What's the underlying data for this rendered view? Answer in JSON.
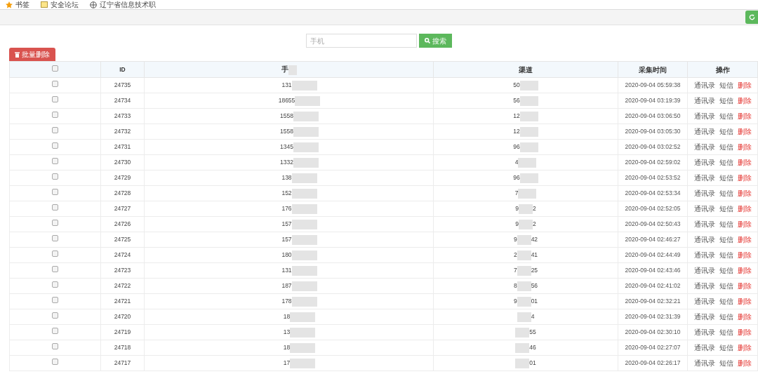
{
  "bookmarks": [
    {
      "kind": "star",
      "label": "书签"
    },
    {
      "kind": "folder",
      "label": "安全论坛"
    },
    {
      "kind": "globe",
      "label": "辽宁省信息技术职"
    }
  ],
  "search": {
    "placeholder": "手机",
    "button": "搜索"
  },
  "batch_delete": "批量删除",
  "table": {
    "select_all": {
      "checked": false
    },
    "columns": [
      "ID",
      "手",
      "渠道",
      "采集时间",
      "操作"
    ],
    "rows": [
      {
        "checked": false,
        "id": "24735",
        "phone": "131",
        "channel": "50",
        "channel_tail": "",
        "time": "2020-09-04 05:59:38",
        "actions": [
          "通讯录",
          "短信",
          "删除"
        ]
      },
      {
        "checked": false,
        "id": "24734",
        "phone": "18655",
        "channel": "56",
        "channel_tail": "",
        "time": "2020-09-04 03:19:39",
        "actions": [
          "通讯录",
          "短信",
          "删除"
        ]
      },
      {
        "checked": false,
        "id": "24733",
        "phone": "1558",
        "channel": "12",
        "channel_tail": "",
        "time": "2020-09-04 03:06:50",
        "actions": [
          "通讯录",
          "短信",
          "删除"
        ]
      },
      {
        "checked": false,
        "id": "24732",
        "phone": "1558",
        "channel": "12",
        "channel_tail": "",
        "time": "2020-09-04 03:05:30",
        "actions": [
          "通讯录",
          "短信",
          "删除"
        ]
      },
      {
        "checked": false,
        "id": "24731",
        "phone": "1345",
        "channel": "96",
        "channel_tail": "",
        "time": "2020-09-04 03:02:52",
        "actions": [
          "通讯录",
          "短信",
          "删除"
        ]
      },
      {
        "checked": false,
        "id": "24730",
        "phone": "1332",
        "channel": "4",
        "channel_tail": "",
        "time": "2020-09-04 02:59:02",
        "actions": [
          "通讯录",
          "短信",
          "删除"
        ]
      },
      {
        "checked": false,
        "id": "24729",
        "phone": "138",
        "channel": "96",
        "channel_tail": "",
        "time": "2020-09-04 02:53:52",
        "actions": [
          "通讯录",
          "短信",
          "删除"
        ]
      },
      {
        "checked": false,
        "id": "24728",
        "phone": "152",
        "channel": "7",
        "channel_tail": "",
        "time": "2020-09-04 02:53:34",
        "actions": [
          "通讯录",
          "短信",
          "删除"
        ]
      },
      {
        "checked": false,
        "id": "24727",
        "phone": "176",
        "channel": "9",
        "channel_tail": "2",
        "time": "2020-09-04 02:52:05",
        "actions": [
          "通讯录",
          "短信",
          "删除"
        ]
      },
      {
        "checked": false,
        "id": "24726",
        "phone": "157",
        "channel": "9",
        "channel_tail": "2",
        "time": "2020-09-04 02:50:43",
        "actions": [
          "通讯录",
          "短信",
          "删除"
        ]
      },
      {
        "checked": false,
        "id": "24725",
        "phone": "157",
        "channel": "9",
        "channel_tail": "42",
        "time": "2020-09-04 02:46:27",
        "actions": [
          "通讯录",
          "短信",
          "删除"
        ]
      },
      {
        "checked": false,
        "id": "24724",
        "phone": "180",
        "channel": "2",
        "channel_tail": "41",
        "time": "2020-09-04 02:44:49",
        "actions": [
          "通讯录",
          "短信",
          "删除"
        ]
      },
      {
        "checked": false,
        "id": "24723",
        "phone": "131",
        "channel": "7",
        "channel_tail": "25",
        "time": "2020-09-04 02:43:46",
        "actions": [
          "通讯录",
          "短信",
          "删除"
        ]
      },
      {
        "checked": false,
        "id": "24722",
        "phone": "187",
        "channel": "8",
        "channel_tail": "56",
        "time": "2020-09-04 02:41:02",
        "actions": [
          "通讯录",
          "短信",
          "删除"
        ]
      },
      {
        "checked": false,
        "id": "24721",
        "phone": "178",
        "channel": "9",
        "channel_tail": "01",
        "time": "2020-09-04 02:32:21",
        "actions": [
          "通讯录",
          "短信",
          "删除"
        ]
      },
      {
        "checked": false,
        "id": "24720",
        "phone": "18",
        "channel": "",
        "channel_tail": "4",
        "time": "2020-09-04 02:31:39",
        "actions": [
          "通讯录",
          "短信",
          "删除"
        ]
      },
      {
        "checked": false,
        "id": "24719",
        "phone": "13",
        "channel": "",
        "channel_tail": "55",
        "time": "2020-09-04 02:30:10",
        "actions": [
          "通讯录",
          "短信",
          "删除"
        ]
      },
      {
        "checked": false,
        "id": "24718",
        "phone": "18",
        "channel": "",
        "channel_tail": "46",
        "time": "2020-09-04 02:27:07",
        "actions": [
          "通讯录",
          "短信",
          "删除"
        ]
      },
      {
        "checked": false,
        "id": "24717",
        "phone": "17",
        "channel": "",
        "channel_tail": "01",
        "time": "2020-09-04 02:26:17",
        "actions": [
          "通讯录",
          "短信",
          "删除"
        ]
      }
    ]
  }
}
